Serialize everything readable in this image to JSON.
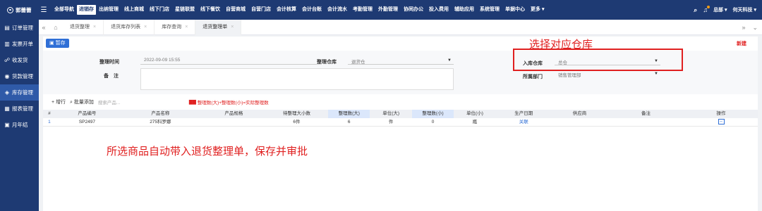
{
  "brand": {
    "name": "郭蕾蕾"
  },
  "nav": {
    "items": [
      "全部导航",
      "进销存",
      "出纳管理",
      "线上商城",
      "线下门店",
      "星链联盟",
      "线下餐饮",
      "自营商城",
      "自营门店",
      "会计核算",
      "会计台账",
      "会计流水",
      "考勤管理",
      "外勤管理",
      "协同办公",
      "投入费用",
      "辅助应用",
      "系统管理",
      "单据中心",
      "更多 ▾"
    ],
    "active_index": 1,
    "right": {
      "org": "总部 ▾",
      "company": "何天科技 ▾"
    }
  },
  "sidebar": {
    "items": [
      {
        "icon": "▤",
        "label": "订单管理"
      },
      {
        "icon": "▥",
        "label": "发票开单"
      },
      {
        "icon": "☍",
        "label": "收发货"
      },
      {
        "icon": "◉",
        "label": "货款管理"
      },
      {
        "icon": "◈",
        "label": "库存管理"
      },
      {
        "icon": "▦",
        "label": "报表管理"
      },
      {
        "icon": "▣",
        "label": "月年结"
      }
    ],
    "active_index": 4
  },
  "tabs": {
    "items": [
      {
        "label": "退货整理"
      },
      {
        "label": "退货库存列表"
      },
      {
        "label": "库存查询"
      },
      {
        "label": "退货整理单"
      }
    ],
    "active_index": 3
  },
  "toolbar": {
    "save_label": "暂存",
    "new_label": "新建"
  },
  "annotation": {
    "select_warehouse": "选择对应仓库",
    "auto_fill": "所选商品自动带入退货整理单，保存并审批"
  },
  "form": {
    "time_label": "整理时间",
    "time_value": "2022-09-09 15:55",
    "warehouse_label": "整理仓库",
    "warehouse_value": "退货仓",
    "remark_label": "备　注",
    "in_warehouse_label": "入库仓库",
    "in_warehouse_value": "总仓",
    "dept_label": "所属部门",
    "dept_value": "销售管理部"
  },
  "ops": {
    "add_row": "+ 增行",
    "batch_add": "批量添加",
    "search_placeholder": "搜索产品...",
    "formula": "整理数(大)+整理数(小)=实际整理数"
  },
  "table": {
    "headers": [
      "#",
      "产品编号",
      "产品名称",
      "产品规格",
      "待整理大小数",
      "整理数(大)",
      "单位(大)",
      "整理数(小)",
      "单位(小)",
      "生产日期",
      "供应商",
      "备注",
      "操作"
    ],
    "rows": [
      [
        "1",
        "SP2497",
        "275科罗娜",
        "",
        "6件",
        "6",
        "件",
        "0",
        "瓶",
        "关联",
        "",
        "",
        ""
      ]
    ]
  }
}
